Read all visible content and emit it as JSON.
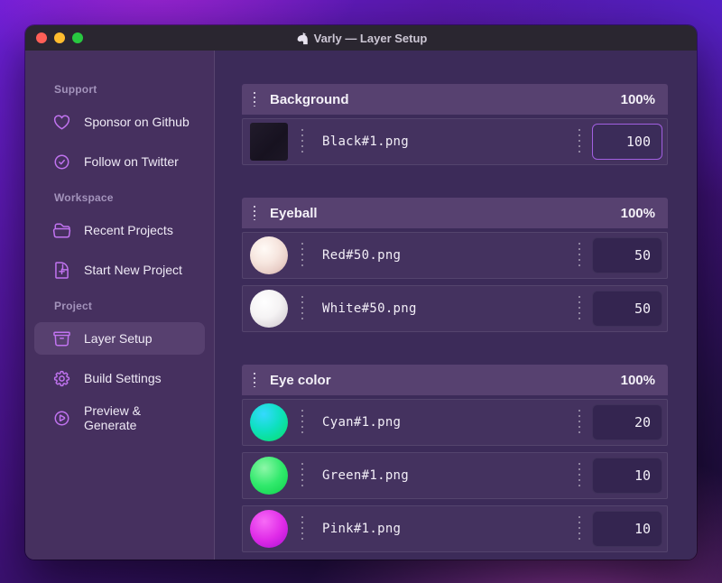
{
  "window": {
    "title": "Varly — Layer Setup",
    "title_icon": "unicorn"
  },
  "sidebar": {
    "sections": [
      {
        "label": "Support",
        "items": [
          {
            "icon": "heart-icon",
            "label": "Sponsor on Github"
          },
          {
            "icon": "check-badge-icon",
            "label": "Follow on Twitter"
          }
        ]
      },
      {
        "label": "Workspace",
        "items": [
          {
            "icon": "folder-open-icon",
            "label": "Recent Projects"
          },
          {
            "icon": "document-plus-icon",
            "label": "Start New Project"
          }
        ]
      },
      {
        "label": "Project",
        "items": [
          {
            "icon": "archive-box-icon",
            "label": "Layer Setup",
            "active": true
          },
          {
            "icon": "gear-icon",
            "label": "Build Settings"
          },
          {
            "icon": "play-circle-icon",
            "label": "Preview & Generate"
          }
        ]
      }
    ]
  },
  "groups": [
    {
      "name": "Background",
      "weight": "100%",
      "layers": [
        {
          "file": "Black#1.png",
          "value": "100",
          "thumb": "black-square",
          "focused": true
        }
      ]
    },
    {
      "name": "Eyeball",
      "weight": "100%",
      "layers": [
        {
          "file": "Red#50.png",
          "value": "50",
          "thumb": "red-ball"
        },
        {
          "file": "White#50.png",
          "value": "50",
          "thumb": "white-ball"
        }
      ]
    },
    {
      "name": "Eye color",
      "weight": "100%",
      "layers": [
        {
          "file": "Cyan#1.png",
          "value": "20",
          "thumb": "cyan-ball"
        },
        {
          "file": "Green#1.png",
          "value": "10",
          "thumb": "green-ball"
        },
        {
          "file": "Pink#1.png",
          "value": "10",
          "thumb": "pink-ball"
        }
      ]
    }
  ],
  "colors": {
    "accent": "#a15fe0",
    "sidebar_icon": "#c173f0",
    "window_main_bg": "#3c2b59",
    "sidebar_bg": "#46305f",
    "group_header_bg": "#574170",
    "traffic_red": "#ff5f57",
    "traffic_yellow": "#febc2e",
    "traffic_green": "#28c840"
  }
}
